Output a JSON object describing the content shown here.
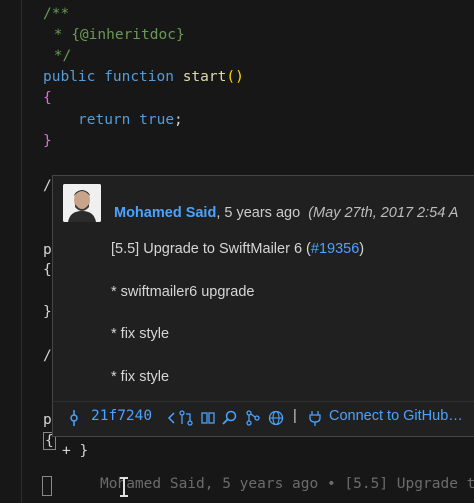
{
  "code": {
    "line1": "/**",
    "line2": " * {@inheritdoc}",
    "line3": " */",
    "kw_public": "public",
    "kw_function": "function",
    "fn_name": "start",
    "parens": "()",
    "open_brace": "{",
    "kw_return": "return",
    "kw_true": "true",
    "semicolon": ";",
    "close_brace": "}",
    "partial_1": "/",
    "partial_2": "p",
    "partial_3": "{",
    "partial_4": "}",
    "partial_5": "/",
    "partial_6": "p",
    "partial_7": "{",
    "bottom_line": "+ }"
  },
  "hover": {
    "author": "Mohamed Said",
    "relative_time": ", 5 years ago",
    "date": "(May 27th, 2017 2:54 A",
    "message_prefix": "[5.5] Upgrade to SwiftMailer 6 (",
    "pr_link": "#19356",
    "message_suffix": ")",
    "bullet1": "* swiftmailer6 upgrade",
    "bullet2": "* fix style",
    "bullet3": "* fix style",
    "commit_sha": "21f7240",
    "connect_label": "Connect to GitHub…",
    "separator": "|"
  },
  "blame_ghost": "Mohamed Said, 5 years ago • [5.5] Upgrade to",
  "icons": [
    "commit-icon",
    "previous-icon",
    "diff-icon",
    "compare-icon",
    "search-icon",
    "graph-icon",
    "globe-icon",
    "plug-icon"
  ]
}
